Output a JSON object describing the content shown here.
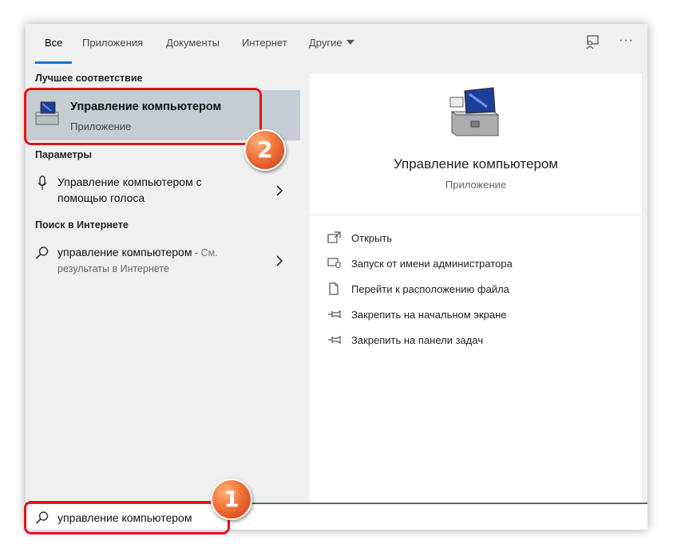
{
  "tabs": [
    {
      "label": "Все",
      "active": true
    },
    {
      "label": "Приложения"
    },
    {
      "label": "Документы"
    },
    {
      "label": "Интернет"
    },
    {
      "label": "Другие"
    }
  ],
  "topbar": {
    "feedback_icon": "feedback-icon",
    "more_label": "···"
  },
  "best_match": {
    "section_title": "Лучшее соответствие",
    "title": "Управление компьютером",
    "subtitle": "Приложение",
    "icon": "computer-management-icon"
  },
  "settings": {
    "section_title": "Параметры",
    "item_line1": "Управление компьютером с",
    "item_line2": "помощью голоса",
    "icon": "microphone-icon"
  },
  "web": {
    "section_title": "Поиск в Интернете",
    "item_main": "управление компьютером",
    "item_suffix": " - См.",
    "item_line2": "результаты в Интернете",
    "icon": "search-icon"
  },
  "detail": {
    "title": "Управление компьютером",
    "subtitle": "Приложение",
    "actions": [
      {
        "label": "Открыть",
        "icon": "open-icon"
      },
      {
        "label": "Запуск от имени администратора",
        "icon": "admin-shield-icon"
      },
      {
        "label": "Перейти к расположению файла",
        "icon": "file-location-icon"
      },
      {
        "label": "Закрепить на начальном экране",
        "icon": "pin-icon"
      },
      {
        "label": "Закрепить на панели задач",
        "icon": "pin-icon"
      }
    ]
  },
  "search": {
    "value": "управление компьютером",
    "icon": "search-icon"
  },
  "callouts": [
    {
      "number": "1",
      "target": "search-input"
    },
    {
      "number": "2",
      "target": "best-match-item"
    }
  ],
  "colors": {
    "accent": "#1a73c8",
    "selected": "#c4cdd2",
    "callout": "#e0161b",
    "badge": "#f27236"
  }
}
